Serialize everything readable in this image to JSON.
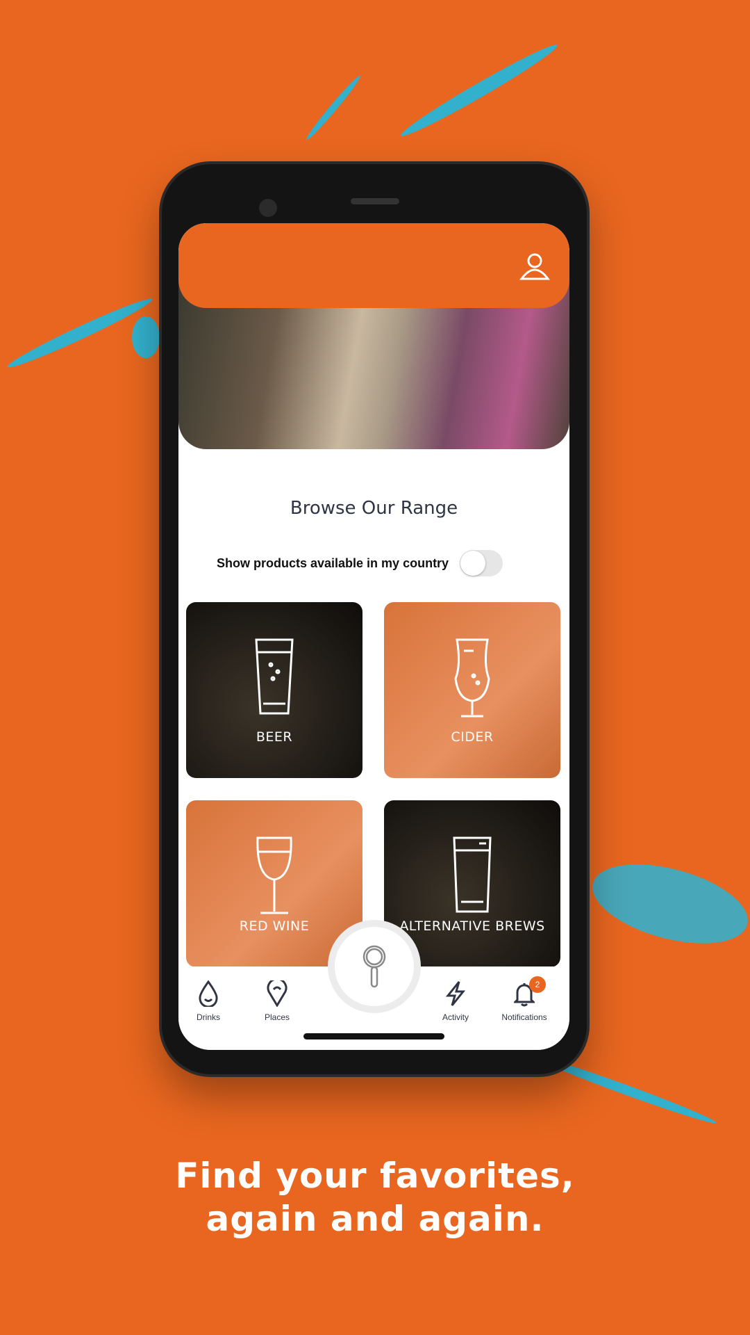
{
  "colors": {
    "accent": "#e8661f",
    "splash": "#1fb8df"
  },
  "header": {
    "icon": "user-icon"
  },
  "main": {
    "title": "Browse Our Range",
    "toggle": {
      "label": "Show products available in my country",
      "on": false
    },
    "categories": [
      {
        "label": "BEER",
        "icon": "beer-glass-icon"
      },
      {
        "label": "CIDER",
        "icon": "cider-glass-icon"
      },
      {
        "label": "RED WINE",
        "icon": "wine-glass-icon"
      },
      {
        "label": "ALTERNATIVE BREWS",
        "icon": "pint-glass-icon"
      }
    ]
  },
  "nav": {
    "items": [
      {
        "label": "Drinks",
        "icon": "drop-icon"
      },
      {
        "label": "Places",
        "icon": "map-pin-icon"
      },
      {
        "label": "Activity",
        "icon": "lightning-icon"
      },
      {
        "label": "Notifications",
        "icon": "bell-icon",
        "badge": "2"
      }
    ],
    "center_icon": "search-icon"
  },
  "caption": {
    "line1": "Find your favorites,",
    "line2": "again and again."
  }
}
